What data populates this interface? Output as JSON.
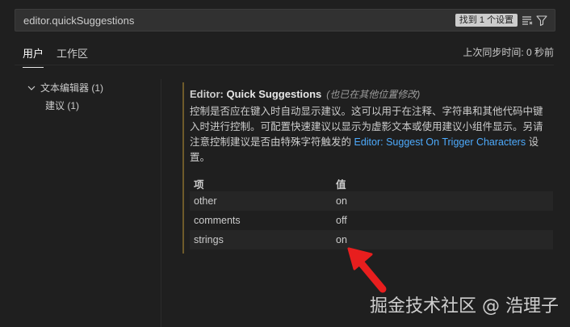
{
  "search": {
    "value": "editor.quickSuggestions",
    "result_badge": "找到 1 个设置"
  },
  "tabs": {
    "user": "用户",
    "workspace": "工作区"
  },
  "sync_status": "上次同步时间: 0 秒前",
  "tree": {
    "parent_label": "文本编辑器 (1)",
    "child_label": "建议 (1)"
  },
  "setting": {
    "category": "Editor: ",
    "name": "Quick Suggestions",
    "modified_note": "(也已在其他位置修改)",
    "desc_part1": "控制是否应在键入时自动显示建议。这可以用于在注释、字符串和其他代码中键入时进行控制。可配置快速建议以显示为虚影文本或使用建议小组件显示。另请注意控制建议是否由特殊字符触发的 ",
    "desc_link": "Editor: Suggest On Trigger Characters",
    "desc_part2": " 设置。",
    "table": {
      "header_key": "项",
      "header_value": "值",
      "rows": [
        {
          "key": "other",
          "value": "on"
        },
        {
          "key": "comments",
          "value": "off"
        },
        {
          "key": "strings",
          "value": "on"
        }
      ]
    }
  },
  "watermark": "掘金技术社区 @ 浩理子",
  "colors": {
    "accent_link": "#4daafc",
    "arrow": "#e81e1e",
    "modified_bar": "#6e5a2a"
  },
  "icons": [
    "clear-filter-list-icon",
    "filter-icon",
    "chevron-down-icon",
    "red-annotation-arrow"
  ]
}
